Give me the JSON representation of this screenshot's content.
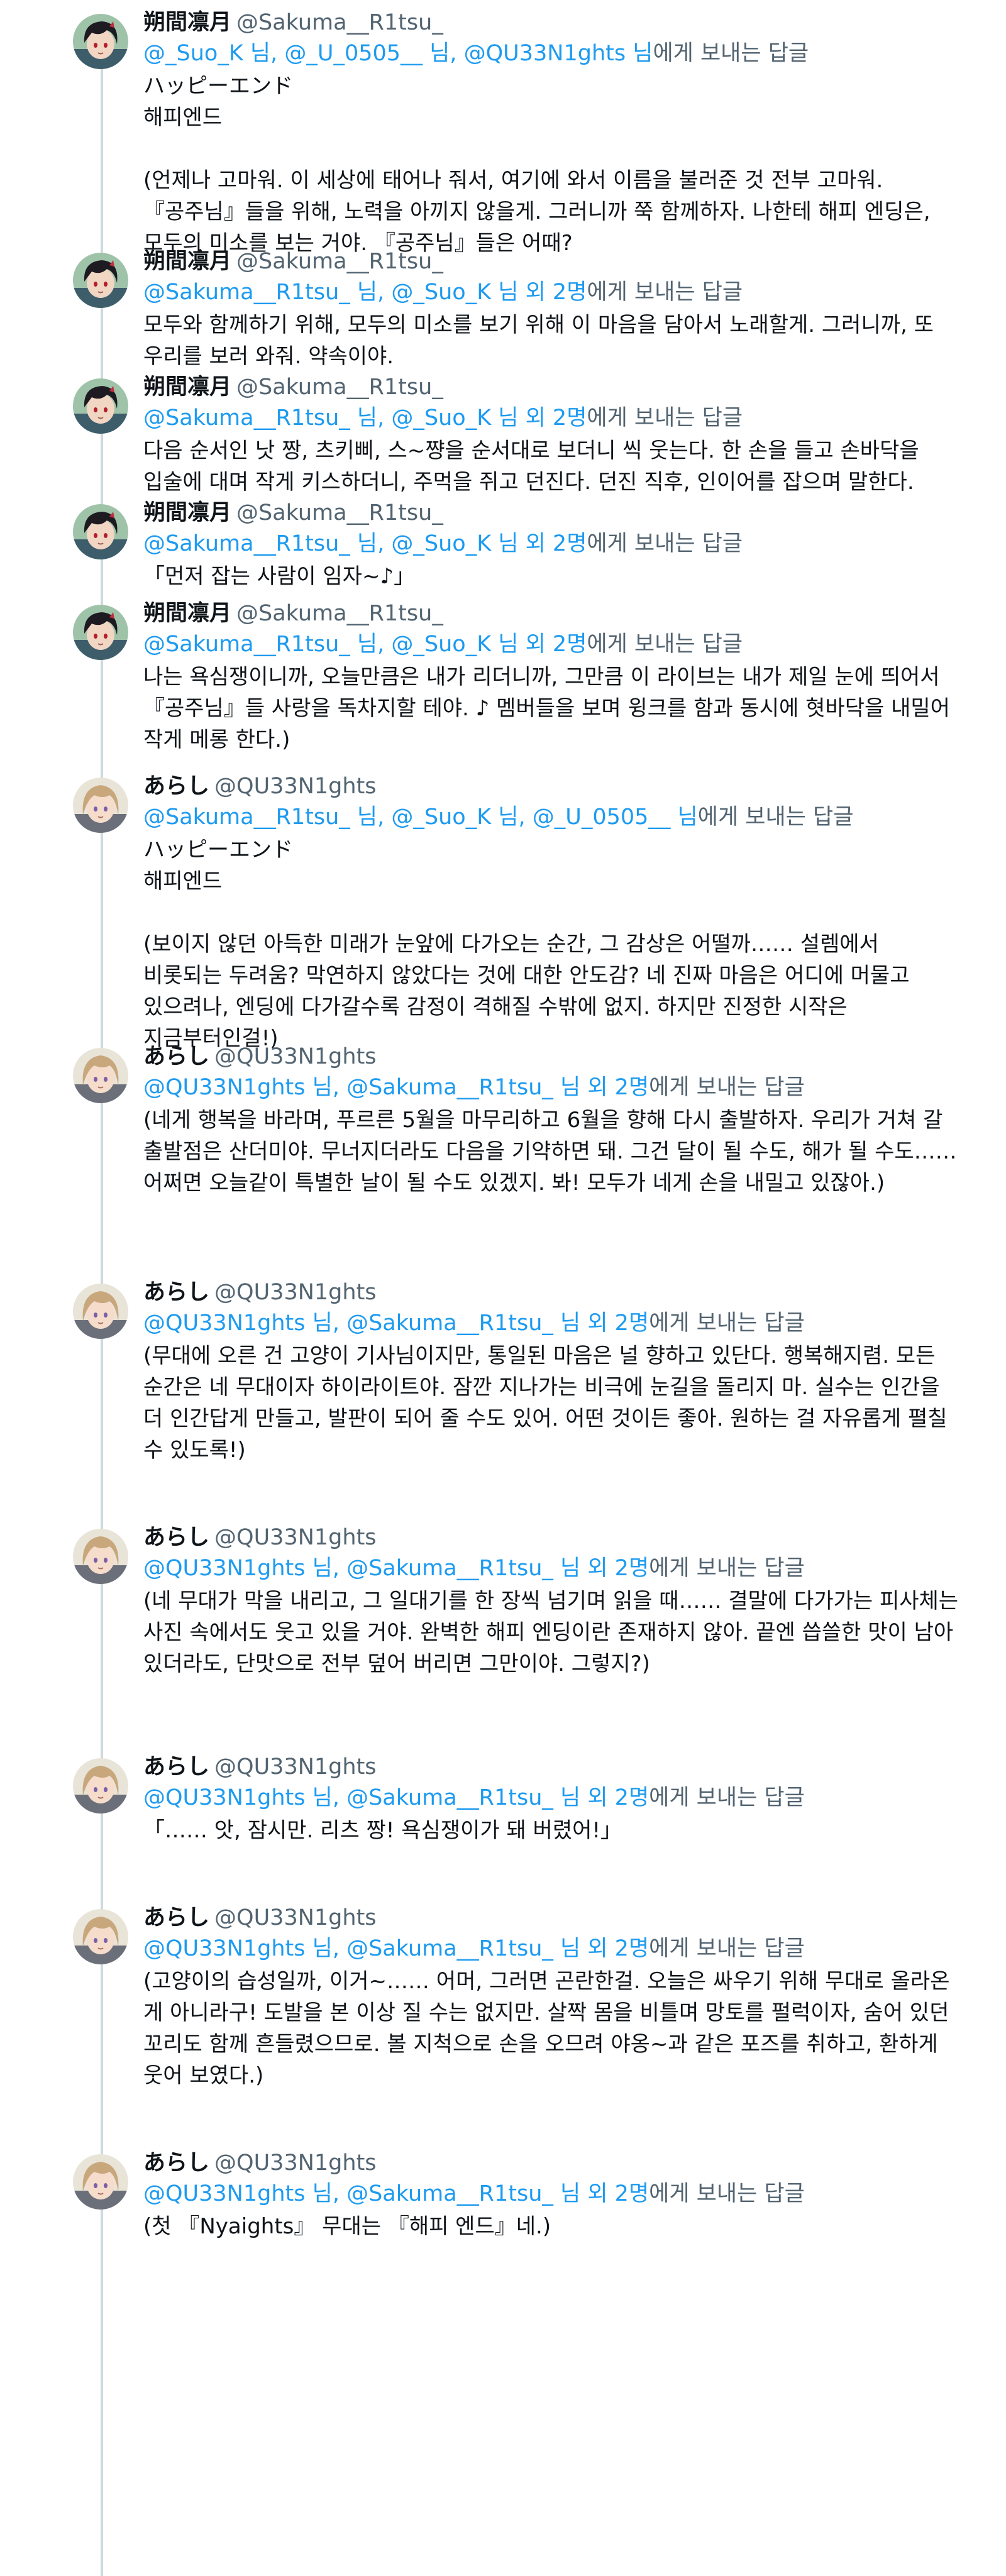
{
  "colors": {
    "link": "#1d9bf0",
    "secondary": "#536471",
    "text": "#0f1419",
    "thread_line": "#cfd9de"
  },
  "reply_suffix": "에게 보내는 답글",
  "tweets": [
    {
      "name": "朔間凛月",
      "handle": "@Sakuma__R1tsu_",
      "reply_to": "@_Suo_K 님, @_U_0505__ 님, @QU33N1ghts 님",
      "avatar": "ritsu-avatar-icon",
      "text": "ハッピーエンド\n해피엔드\n\n(언제나 고마워. 이 세상에 태어나 줘서, 여기에 와서 이름을 불러준 것 전부 고마워. 『공주님』들을 위해, 노력을 아끼지 않을게. 그러니까 쭉 함께하자. 나한테 해피 엔딩은, 모두의 미소를 보는 거야. 『공주님』들은 어때?"
    },
    {
      "name": "朔間凛月",
      "handle": "@Sakuma__R1tsu_",
      "reply_to": "@Sakuma__R1tsu_ 님, @_Suo_K 님 외 2명",
      "avatar": "ritsu-avatar-icon",
      "text": "모두와 함께하기 위해, 모두의 미소를 보기 위해 이 마음을 담아서 노래할게. 그러니까, 또 우리를 보러 와줘. 약속이야."
    },
    {
      "name": "朔間凛月",
      "handle": "@Sakuma__R1tsu_",
      "reply_to": "@Sakuma__R1tsu_ 님, @_Suo_K 님 외 2명",
      "avatar": "ritsu-avatar-icon",
      "text": "다음 순서인 낫 짱, 츠키삐, 스~쨩을 순서대로 보더니 씩 웃는다. 한 손을 들고 손바닥을 입술에 대며 작게 키스하더니, 주먹을 쥐고 던진다. 던진 직후, 인이어를 잡으며 말한다."
    },
    {
      "name": "朔間凛月",
      "handle": "@Sakuma__R1tsu_",
      "reply_to": "@Sakuma__R1tsu_ 님, @_Suo_K 님 외 2명",
      "avatar": "ritsu-avatar-icon",
      "text": "「먼저 잡는 사람이 임자~♪」"
    },
    {
      "name": "朔間凛月",
      "handle": "@Sakuma__R1tsu_",
      "reply_to": "@Sakuma__R1tsu_ 님, @_Suo_K 님 외 2명",
      "avatar": "ritsu-avatar-icon",
      "text": "나는 욕심쟁이니까, 오늘만큼은 내가 리더니까, 그만큼 이 라이브는 내가 제일 눈에 띄어서 『공주님』들 사랑을 독차지할 테야. ♪ 멤버들을 보며 윙크를 함과 동시에 혓바닥을 내밀어 작게 메롱 한다.)"
    },
    {
      "name": "あらし",
      "handle": "@QU33N1ghts",
      "reply_to": "@Sakuma__R1tsu_ 님, @_Suo_K 님, @_U_0505__ 님",
      "avatar": "arashi-avatar-icon",
      "text": "ハッピーエンド\n해피엔드\n\n(보이지 않던 아득한 미래가 눈앞에 다가오는 순간, 그 감상은 어떨까…… 설렘에서 비롯되는 두려움? 막연하지 않았다는 것에 대한 안도감? 네 진짜 마음은 어디에 머물고 있으려나, 엔딩에 다가갈수록 감정이 격해질 수밖에 없지. 하지만 진정한 시작은 지금부터인걸!)"
    },
    {
      "name": "あらし",
      "handle": "@QU33N1ghts",
      "reply_to": "@QU33N1ghts 님, @Sakuma__R1tsu_ 님 외 2명",
      "avatar": "arashi-avatar-icon",
      "text": "(네게 행복을 바라며, 푸르른 5월을 마무리하고 6월을 향해 다시 출발하자. 우리가 거쳐 갈 출발점은 산더미야. 무너지더라도 다음을 기약하면 돼. 그건 달이 될 수도, 해가 될 수도…… 어쩌면 오늘같이 특별한 날이 될 수도 있겠지. 봐! 모두가 네게 손을 내밀고 있잖아.)"
    },
    {
      "name": "あらし",
      "handle": "@QU33N1ghts",
      "reply_to": "@QU33N1ghts 님, @Sakuma__R1tsu_ 님 외 2명",
      "avatar": "arashi-avatar-icon",
      "text": "(무대에 오른 건 고양이 기사님이지만, 통일된 마음은 널 향하고 있단다. 행복해지렴. 모든 순간은 네 무대이자 하이라이트야. 잠깐 지나가는 비극에 눈길을 돌리지 마. 실수는 인간을 더 인간답게 만들고, 발판이 되어 줄 수도 있어. 어떤 것이든 좋아. 원하는 걸 자유롭게 펼칠 수 있도록!)"
    },
    {
      "name": "あらし",
      "handle": "@QU33N1ghts",
      "reply_to": "@QU33N1ghts 님, @Sakuma__R1tsu_ 님 외 2명",
      "avatar": "arashi-avatar-icon",
      "text": "(네 무대가 막을 내리고, 그 일대기를 한 장씩 넘기며 읽을 때…… 결말에 다가가는 피사체는 사진 속에서도 웃고 있을 거야. 완벽한 해피 엔딩이란 존재하지 않아. 끝엔 씁쓸한 맛이 남아 있더라도, 단맛으로 전부 덮어 버리면 그만이야. 그렇지?)"
    },
    {
      "name": "あらし",
      "handle": "@QU33N1ghts",
      "reply_to": "@QU33N1ghts 님, @Sakuma__R1tsu_ 님 외 2명",
      "avatar": "arashi-avatar-icon",
      "text": "「…… 앗, 잠시만. 리츠 짱! 욕심쟁이가 돼 버렸어!」"
    },
    {
      "name": "あらし",
      "handle": "@QU33N1ghts",
      "reply_to": "@QU33N1ghts 님, @Sakuma__R1tsu_ 님 외 2명",
      "avatar": "arashi-avatar-icon",
      "text": "(고양이의 습성일까, 이거~…… 어머, 그러면 곤란한걸. 오늘은 싸우기 위해 무대로 올라온 게 아니라구! 도발을 본 이상 질 수는 없지만. 살짝 몸을 비틀며 망토를 펄럭이자, 숨어 있던 꼬리도 함께 흔들렸으므로. 볼 지척으로 손을 오므려 야옹~과 같은 포즈를 취하고, 환하게 웃어 보였다.)"
    },
    {
      "name": "あらし",
      "handle": "@QU33N1ghts",
      "reply_to": "@QU33N1ghts 님, @Sakuma__R1tsu_ 님 외 2명",
      "avatar": "arashi-avatar-icon",
      "text": "(첫 『Nyaights』 무대는 『해피 엔드』네.)"
    }
  ]
}
